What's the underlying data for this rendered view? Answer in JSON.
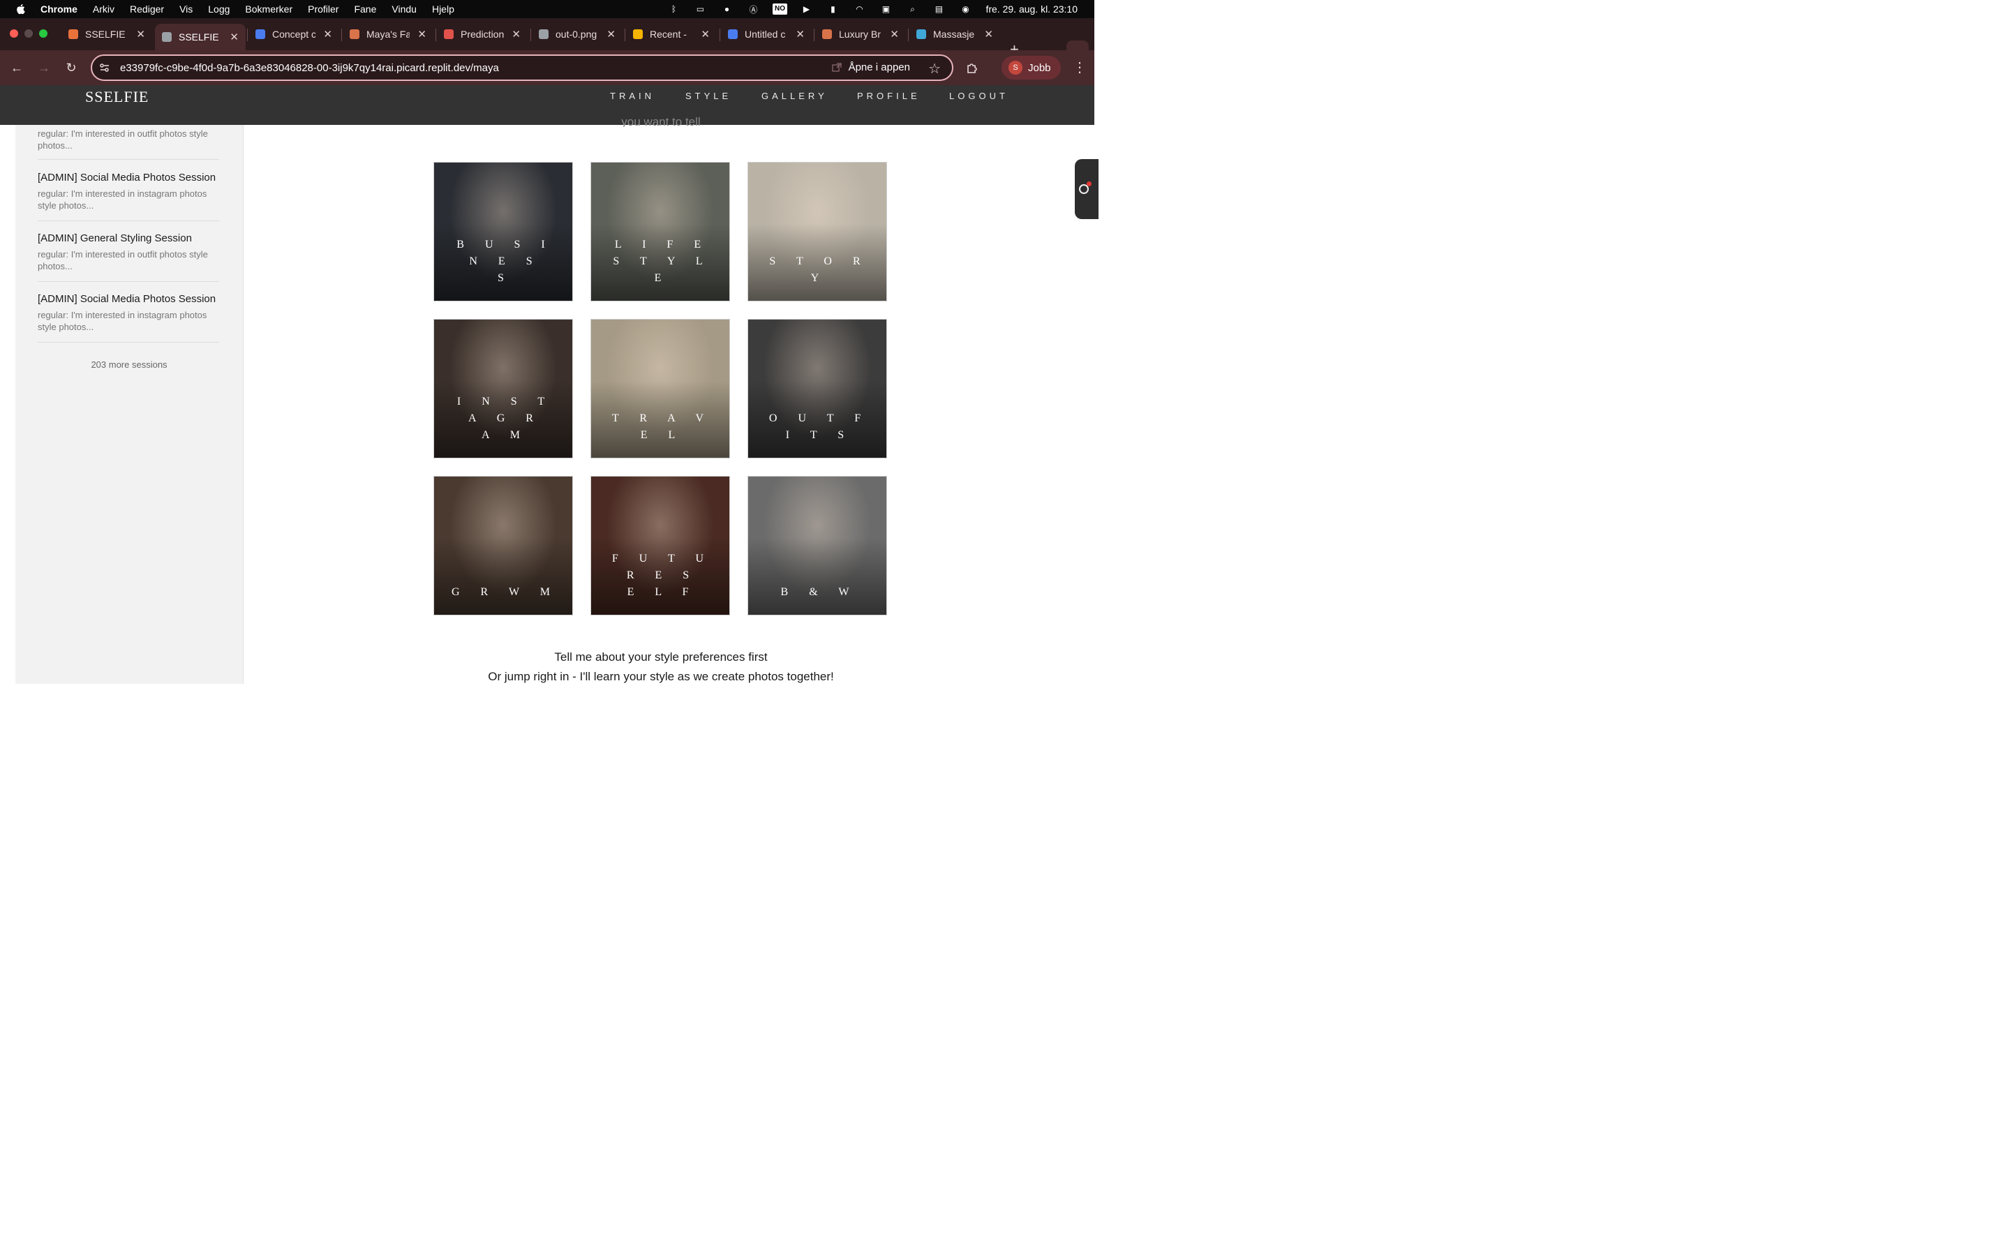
{
  "menubar": {
    "items": [
      "Chrome",
      "Arkiv",
      "Rediger",
      "Vis",
      "Logg",
      "Bokmerker",
      "Profiler",
      "Fane",
      "Vindu",
      "Hjelp"
    ],
    "keyboard_layout": "NO",
    "clock": "fre. 29. aug. kl. 23:10",
    "status_icons": [
      "bluetooth-icon",
      "cast-icon",
      "grammarly-icon",
      "accessibility-icon",
      "keyboard-layout-icon",
      "play-icon",
      "battery-icon",
      "wifi-icon",
      "screen-mirror-icon",
      "spotlight-search-icon",
      "control-center-icon",
      "siri-icon"
    ]
  },
  "tabs": [
    {
      "label": "SSELFIE S",
      "favicon_color": "#e8723a"
    },
    {
      "label": "SSELFIE S",
      "favicon_color": "#9aa0a6"
    },
    {
      "label": "Concept c",
      "favicon_color": "#4a7cf0"
    },
    {
      "label": "Maya's Fa",
      "favicon_color": "#d9734a"
    },
    {
      "label": "Prediction",
      "favicon_color": "#e0524a"
    },
    {
      "label": "out-0.png",
      "favicon_color": "#9aa0a6"
    },
    {
      "label": "Recent -",
      "favicon_color": "#f4b400"
    },
    {
      "label": "Untitled c",
      "favicon_color": "#4a7cf0"
    },
    {
      "label": "Luxury Br",
      "favicon_color": "#d9734a"
    },
    {
      "label": "Massasje",
      "favicon_color": "#3fa8d8"
    }
  ],
  "toolbar": {
    "url": "e33979fc-c9be-4f0d-9a7b-6a3e83046828-00-3ij9k7qy14rai.picard.replit.dev/maya",
    "open_in_app": "Åpne i appen",
    "profile_initial": "S",
    "profile_name": "Jobb"
  },
  "site": {
    "brand": "SSELFIE",
    "nav": [
      "TRAIN",
      "STYLE",
      "GALLERY",
      "PROFILE",
      "LOGOUT"
    ]
  },
  "sidebar": {
    "sessions": [
      {
        "title": "",
        "preview": "regular: I'm interested in outfit photos style photos..."
      },
      {
        "title": "[ADMIN] Social Media Photos Session",
        "preview": "regular: I'm interested in instagram photos style photos..."
      },
      {
        "title": "[ADMIN] General Styling Session",
        "preview": "regular: I'm interested in outfit photos style photos..."
      },
      {
        "title": "[ADMIN] Social Media Photos Session",
        "preview": "regular: I'm interested in instagram photos style photos..."
      }
    ],
    "more_sessions": "203 more sessions"
  },
  "main": {
    "intro_cut": "you want to tell",
    "categories": [
      {
        "label": "BUSINESS",
        "line1": "B U S I N E S",
        "line2": "S",
        "bg": "#2a2d33"
      },
      {
        "label": "LIFESTYLE",
        "line1": "L I F E S T Y L",
        "line2": "E",
        "bg": "#5d6058"
      },
      {
        "label": "STORY",
        "line1": "S T O R Y",
        "line2": "",
        "bg": "#b9b2a5"
      },
      {
        "label": "INSTAGRAM",
        "line1": "I N S T A G R",
        "line2": "A M",
        "bg": "#3a2f2a"
      },
      {
        "label": "TRAVEL",
        "line1": "T R A V E L",
        "line2": "",
        "bg": "#a59a85"
      },
      {
        "label": "OUTFITS",
        "line1": "O U T F I T S",
        "line2": "",
        "bg": "#3d3c3c"
      },
      {
        "label": "GRWM",
        "line1": "G R W M",
        "line2": "",
        "bg": "#4a3a30"
      },
      {
        "label": "FUTURESELF",
        "line1": "F U T U R E S",
        "line2": "E L F",
        "bg": "#4a2a22"
      },
      {
        "label": "B & W",
        "line1": "B & W",
        "line2": "",
        "bg": "#6b6b6b"
      }
    ],
    "prompt_line1": "Tell me about your style preferences first",
    "prompt_line2": "Or jump right in - I'll learn your style as we create photos together!"
  }
}
